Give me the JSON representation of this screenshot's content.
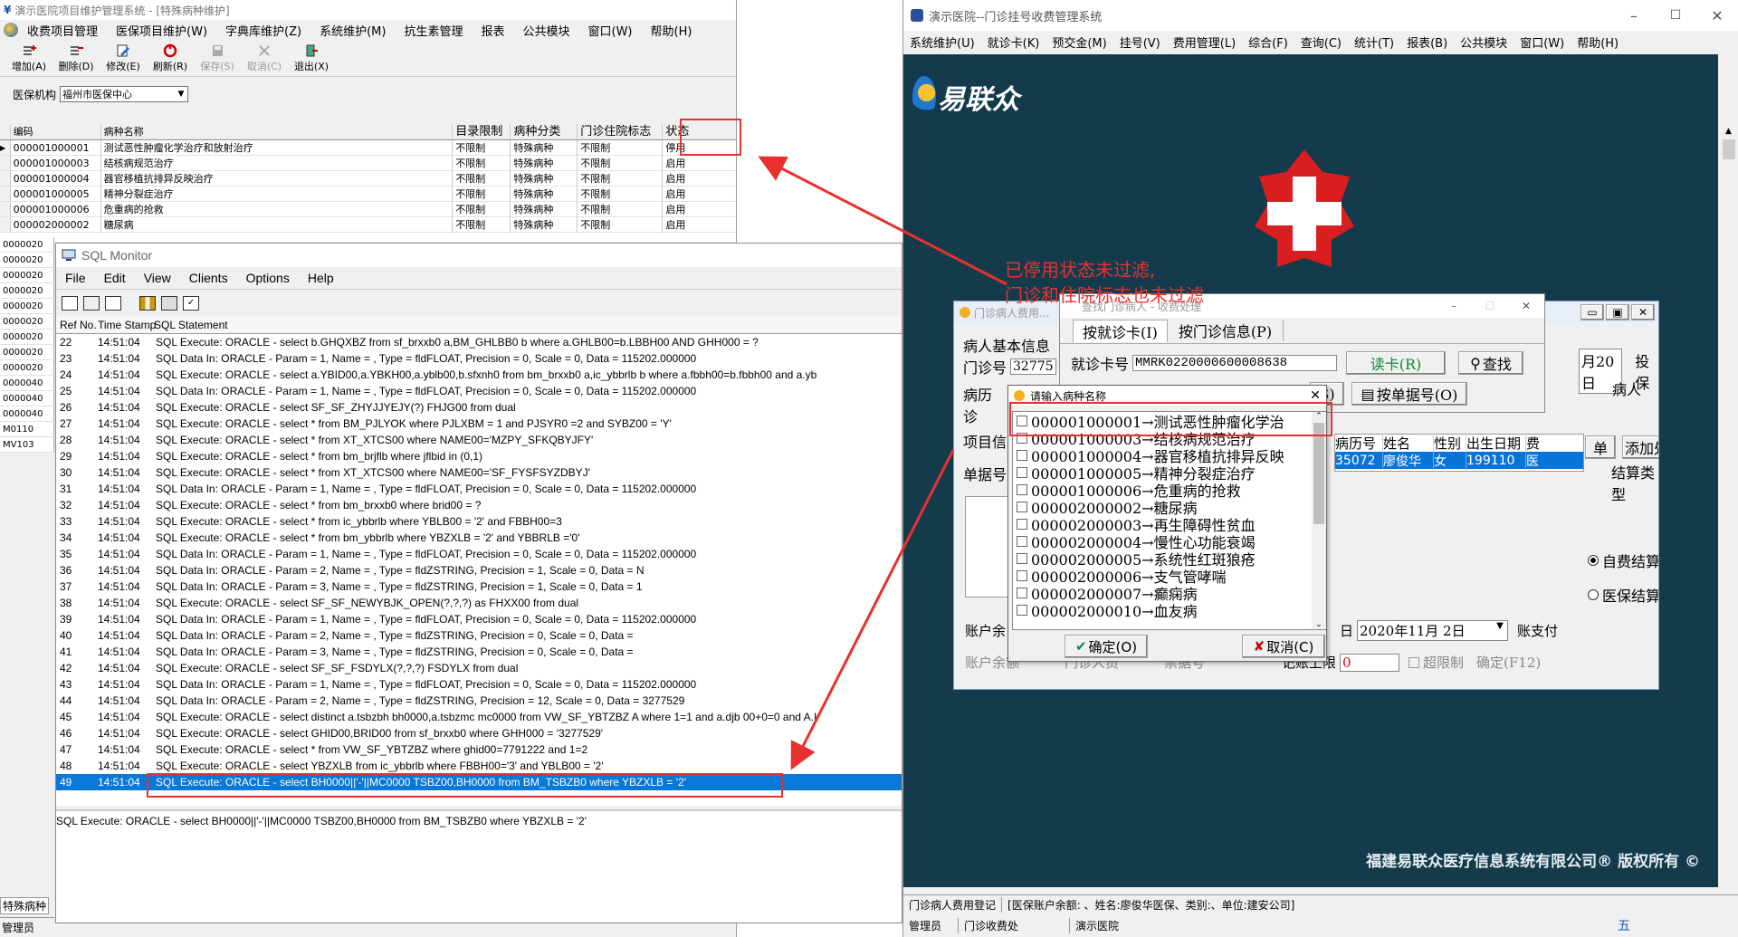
{
  "left_app": {
    "title": "演示医院项目维护管理系统 - [特殊病种维护]",
    "menu": [
      "收费项目管理",
      "医保项目维护(W)",
      "字典库维护(Z)",
      "系统维护(M)",
      "抗生素管理",
      "报表",
      "公共模块",
      "窗口(W)",
      "帮助(H)"
    ],
    "toolbar": [
      {
        "label": "增加(A)",
        "icon": "add-icon"
      },
      {
        "label": "删除(D)",
        "icon": "delete-icon"
      },
      {
        "label": "修改(E)",
        "icon": "edit-icon"
      },
      {
        "label": "刷新(R)",
        "icon": "refresh-icon"
      },
      {
        "label": "保存(S)",
        "icon": "save-icon"
      },
      {
        "label": "取消(C)",
        "icon": "cancel-icon"
      },
      {
        "label": "退出(X)",
        "icon": "exit-icon"
      }
    ],
    "insurer_label": "医保机构",
    "insurer_value": "福州市医保中心",
    "grid_headers": [
      "编码",
      "病种名称",
      "目录限制",
      "病种分类",
      "门诊住院标志",
      "状态"
    ],
    "grid_rows": [
      [
        "000001000001",
        "测试恶性肿瘤化学治疗和放射治疗",
        "不限制",
        "特殊病种",
        "不限制",
        "停用"
      ],
      [
        "000001000003",
        "结核病规范治疗",
        "不限制",
        "特殊病种",
        "不限制",
        "启用"
      ],
      [
        "000001000004",
        "器官移植抗排异反映治疗",
        "不限制",
        "特殊病种",
        "不限制",
        "启用"
      ],
      [
        "000001000005",
        "精神分裂症治疗",
        "不限制",
        "特殊病种",
        "不限制",
        "启用"
      ],
      [
        "000001000006",
        "危重病的抢救",
        "不限制",
        "特殊病种",
        "不限制",
        "启用"
      ],
      [
        "000002000002",
        "糖尿病",
        "不限制",
        "特殊病种",
        "不限制",
        "启用"
      ]
    ],
    "left_codes": [
      "0000020",
      "0000020",
      "0000020",
      "0000020",
      "0000020",
      "0000020",
      "0000020",
      "0000020",
      "0000020",
      "0000040",
      "0000040",
      "0000040",
      "M0110",
      "MV103"
    ],
    "bottom_tab": "特殊病种",
    "status_user": "管理员"
  },
  "sql_monitor": {
    "title": "SQL Monitor",
    "menu": [
      "File",
      "Edit",
      "View",
      "Clients",
      "Options",
      "Help"
    ],
    "headers": [
      "Ref No.",
      "Time Stamp",
      "SQL Statement"
    ],
    "rows": [
      [
        "22",
        "14:51:04",
        "SQL Execute: ORACLE - select b.GHQXBZ from sf_brxxb0 a,BM_GHLBB0 b where a.GHLB00=b.LBBH00 AND GHH000 = ?"
      ],
      [
        "23",
        "14:51:04",
        "SQL Data In: ORACLE - Param = 1, Name = , Type = fldFLOAT, Precision = 0, Scale = 0, Data = 115202.000000"
      ],
      [
        "24",
        "14:51:04",
        "SQL Execute: ORACLE - select a.YBID00,a.YBKH00,a.yblb00,b.sfxnh0 from bm_brxxb0 a,ic_ybbrlb b where a.fbbh00=b.fbbh00 and a.yb"
      ],
      [
        "25",
        "14:51:04",
        "SQL Data In: ORACLE - Param = 1, Name = , Type = fldFLOAT, Precision = 0, Scale = 0, Data = 115202.000000"
      ],
      [
        "26",
        "14:51:04",
        "SQL Execute: ORACLE - select SF_SF_ZHYJJYEJY(?) FHJG00 from dual"
      ],
      [
        "27",
        "14:51:04",
        "SQL Execute: ORACLE - select * from BM_PJLYOK where PJLXBM = 1  and PJSYR0 =2 and SYBZ00 = 'Y'"
      ],
      [
        "28",
        "14:51:04",
        "SQL Execute: ORACLE - select * from XT_XTCS00 where NAME00='MZPY_SFKQBYJFY'"
      ],
      [
        "29",
        "14:51:04",
        "SQL Execute: ORACLE - select * from bm_brjflb where jflbid in (0,1)"
      ],
      [
        "30",
        "14:51:04",
        "SQL Execute: ORACLE - select * from XT_XTCS00 where NAME00='SF_FYSFSYZDBYJ'"
      ],
      [
        "31",
        "14:51:04",
        "SQL Data In: ORACLE - Param = 1, Name = , Type = fldFLOAT, Precision = 0, Scale = 0, Data = 115202.000000"
      ],
      [
        "32",
        "14:51:04",
        "SQL Execute: ORACLE - select * from bm_brxxb0 where brid00 = ?"
      ],
      [
        "33",
        "14:51:04",
        "SQL Execute: ORACLE - select * from ic_ybbrlb where YBLB00 = '2' and FBBH00=3"
      ],
      [
        "34",
        "14:51:04",
        "SQL Execute: ORACLE - select * from bm_ybbrlb where YBZXLB = '2' and YBBRLB ='0'"
      ],
      [
        "35",
        "14:51:04",
        "SQL Data In: ORACLE - Param = 1, Name = , Type = fldFLOAT, Precision = 0, Scale = 0, Data = 115202.000000"
      ],
      [
        "36",
        "14:51:04",
        "SQL Data In: ORACLE - Param = 2, Name = , Type = fldZSTRING, Precision = 1, Scale = 0, Data = N"
      ],
      [
        "37",
        "14:51:04",
        "SQL Data In: ORACLE - Param = 3, Name = , Type = fldZSTRING, Precision = 1, Scale = 0, Data = 1"
      ],
      [
        "38",
        "14:51:04",
        "SQL Execute: ORACLE - select SF_SF_NEWYBJK_OPEN(?,?,?) as FHXX00 from dual"
      ],
      [
        "39",
        "14:51:04",
        "SQL Data In: ORACLE - Param = 1, Name = , Type = fldFLOAT, Precision = 0, Scale = 0, Data = 115202.000000"
      ],
      [
        "40",
        "14:51:04",
        "SQL Data In: ORACLE - Param = 2, Name = , Type = fldZSTRING, Precision = 0, Scale = 0, Data ="
      ],
      [
        "41",
        "14:51:04",
        "SQL Data In: ORACLE - Param = 3, Name = , Type = fldZSTRING, Precision = 0, Scale = 0, Data ="
      ],
      [
        "42",
        "14:51:04",
        "SQL Execute: ORACLE - select SF_SF_FSDYLX(?,?,?) FSDYLX from dual"
      ],
      [
        "43",
        "14:51:04",
        "SQL Data In: ORACLE - Param = 1, Name = , Type = fldFLOAT, Precision = 0, Scale = 0, Data = 115202.000000"
      ],
      [
        "44",
        "14:51:04",
        "SQL Data In: ORACLE - Param = 2, Name = , Type = fldZSTRING, Precision = 12, Scale = 0, Data = 3277529"
      ],
      [
        "45",
        "14:51:04",
        "SQL Execute: ORACLE - select distinct a.tsbzbh bh0000,a.tsbzmc mc0000 from VW_SF_YBTZBZ A where 1=1 and a.djb 00+0=0 and A.I"
      ],
      [
        "46",
        "14:51:04",
        "SQL Execute: ORACLE - select GHID00,BRID00 from sf_brxxb0 where GHH000 = '3277529'"
      ],
      [
        "47",
        "14:51:04",
        "SQL Execute: ORACLE - select * from VW_SF_YBTZBZ where ghid00=7791222 and 1=2"
      ],
      [
        "48",
        "14:51:04",
        "SQL Execute: ORACLE - select YBZXLB from ic_ybbrlb where FBBH00='3' and YBLB00 = '2'"
      ],
      [
        "49",
        "14:51:04",
        "SQL Execute: ORACLE - select BH0000||'-'||MC0000 TSBZ00,BH0000 from BM_TSBZB0 where YBZXLB = '2'"
      ]
    ],
    "detail": "SQL Execute: ORACLE - select BH0000||'-'||MC0000 TSBZ00,BH0000 from BM_TSBZB0 where YBZXLB = '2'"
  },
  "right_app": {
    "title": "演示医院--门诊挂号收费管理系统",
    "menu": [
      "系统维护(U)",
      "就诊卡(K)",
      "预交金(M)",
      "挂号(V)",
      "费用管理(L)",
      "综合(F)",
      "查询(C)",
      "统计(T)",
      "报表(B)",
      "公共模块",
      "窗口(W)",
      "帮助(H)"
    ],
    "logo_text": "易联众",
    "copyright": "福建易联众医疗信息系统有限公司® 版权所有 ©",
    "status_bar": [
      "门诊病人费用登记",
      "[医保账户余额: 、姓名:廖俊华医保、类别:、单位:建安公司]"
    ],
    "bottom_bar": [
      "管理员",
      "门诊收费处",
      "演示医院"
    ],
    "ime_text": "五"
  },
  "fee_window": {
    "title": "门诊病人费用...",
    "labels": {
      "patient_info": "病人基本信息",
      "clinic_no": "门诊号",
      "clinic_no_value": "32775",
      "record": "病历",
      "diag": "诊",
      "item_info": "项目信",
      "list_no": "单据号",
      "account": "账户余",
      "account_balance": "账户余额",
      "people": "门诊人员",
      "ticket": "票据号",
      "date_suffix": "月20日",
      "visit_type": "投保",
      "patient": "病人",
      "bill": "单",
      "add_rx": "添加处方",
      "settle_type": "结算类型",
      "self_pay": "自费结算",
      "ins_pay": "医保结算",
      "date_value": "2020年11月 2日",
      "date_label": "日",
      "account_pay": "账支付",
      "charge_limit": "记账上限",
      "charge_limit_value": "0",
      "over_limit": "超限制",
      "confirm_f12": "确定(F12)"
    },
    "grid_headers": [
      "病历号",
      "姓名",
      "性别",
      "出生日期",
      "费"
    ],
    "grid_row": [
      "35072",
      "廖俊华",
      "女",
      "199110",
      "医"
    ]
  },
  "search_window": {
    "title": "查找门诊病人 - 收费处理",
    "tabs": [
      "按就诊卡(I)",
      "按门诊信息(P)"
    ],
    "card_label": "就诊卡号",
    "card_value": "MMRK0220000600008638",
    "read_card": "读卡(R)",
    "search": "查找",
    "by_bill": "按单据号(O)",
    "s_btn": "S)"
  },
  "disease_dialog": {
    "title": "请输入病种名称",
    "items": [
      "000001000001→测试恶性肿瘤化学治",
      "000001000003→结核病规范治疗",
      "000001000004→器官移植抗排异反映",
      "000001000005→精神分裂症治疗",
      "000001000006→危重病的抢救",
      "000002000002→糖尿病",
      "000002000003→再生障碍性贫血",
      "000002000004→慢性心功能衰竭",
      "000002000005→系统性红斑狼疮",
      "000002000006→支气管哮喘",
      "000002000007→癫痫病",
      "000002000010→血友病"
    ],
    "ok": "确定(O)",
    "cancel": "取消(C)"
  },
  "annotation": {
    "text_line1": "已停用状态未过滤,",
    "text_line2": "门诊和住院标志也未过滤",
    "color": "#e8312f"
  }
}
